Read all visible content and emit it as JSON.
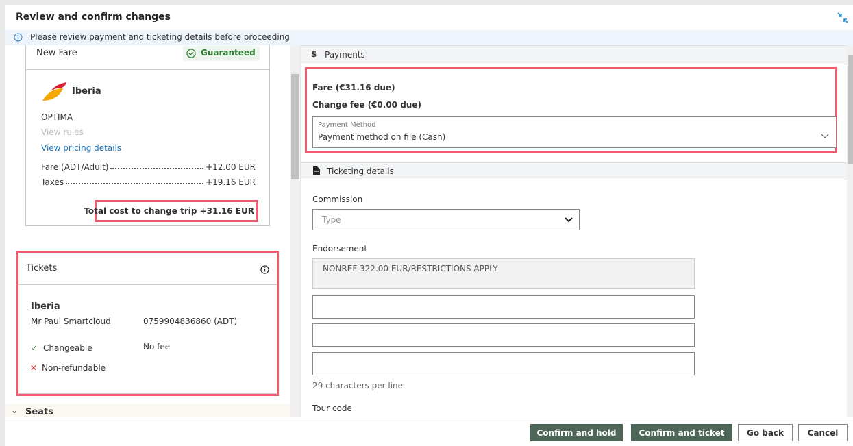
{
  "dialog": {
    "title": "Review and confirm changes",
    "info": "Please review payment and ticketing details before proceeding"
  },
  "new_fare": {
    "title": "New Fare",
    "badge": "Guaranteed",
    "airline": "Iberia",
    "fare_brand": "OPTIMA",
    "view_rules": "View rules",
    "view_pricing": "View pricing details",
    "lines": [
      {
        "label": "Fare (ADT/Adult)",
        "value": "+12.00 EUR"
      },
      {
        "label": "Taxes",
        "value": "+19.16 EUR"
      }
    ],
    "total": "Total cost to change trip +31.16 EUR"
  },
  "tickets": {
    "title": "Tickets",
    "airline": "Iberia",
    "passenger": "Mr Paul Smartcloud",
    "ticket_number": "0759904836860 (ADT)",
    "changeable": "Changeable",
    "change_fee": "No fee",
    "refundable": "Non-refundable"
  },
  "seats": {
    "title": "Seats"
  },
  "payments": {
    "title": "Payments",
    "fare_due": "Fare (€31.16 due)",
    "change_fee_due": "Change fee (€0.00 due)",
    "method_label": "Payment Method",
    "method_value": "Payment method on file (Cash)"
  },
  "ticketing": {
    "title": "Ticketing details",
    "commission_label": "Commission",
    "commission_placeholder": "Type",
    "endorsement_label": "Endorsement",
    "endorsement_value": "NONREF 322.00 EUR/RESTRICTIONS APPLY",
    "chars_hint": "29 characters per line",
    "tour_code_label": "Tour code"
  },
  "footer": {
    "confirm_hold": "Confirm and hold",
    "confirm_ticket": "Confirm and ticket",
    "go_back": "Go back",
    "cancel": "Cancel"
  },
  "colors": {
    "primary_button": "#4d6657",
    "highlight": "#f25a6e",
    "link": "#1a73b8",
    "success": "#2e7d32",
    "error": "#d32f2f"
  }
}
